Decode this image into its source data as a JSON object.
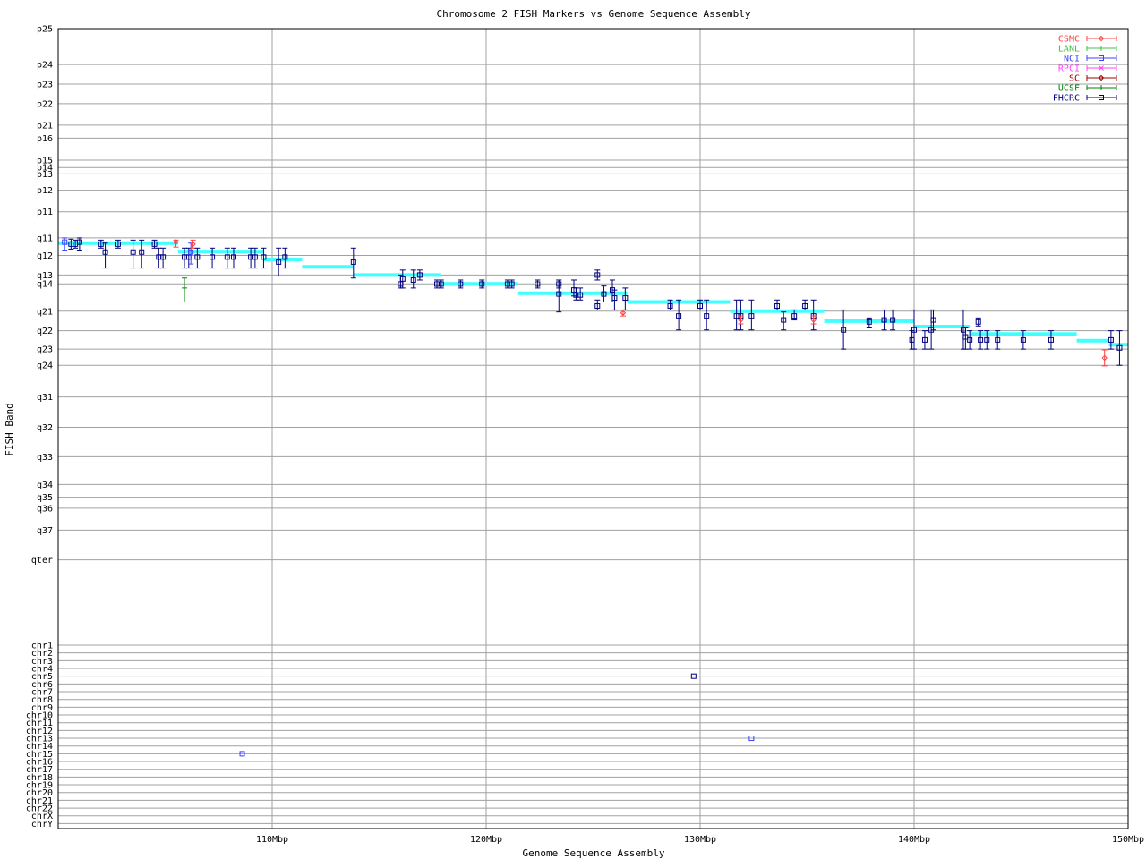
{
  "chart_data": {
    "type": "scatter",
    "title": "Chromosome 2 FISH Markers vs Genome Sequence Assembly",
    "xlabel": "Genome Sequence Assembly",
    "ylabel": "FISH Band",
    "x_range_mbp": [
      100,
      150
    ],
    "x_ticks": [
      {
        "value": 110,
        "label": "110Mbp"
      },
      {
        "value": 120,
        "label": "120Mbp"
      },
      {
        "value": 130,
        "label": "130Mbp"
      },
      {
        "value": 140,
        "label": "140Mbp"
      },
      {
        "value": 150,
        "label": "150Mbp"
      }
    ],
    "grid": true,
    "legend_position": "top-right",
    "bands": [
      {
        "label": "p25",
        "pos": 0
      },
      {
        "label": "p24",
        "pos": 1.8
      },
      {
        "label": "p23",
        "pos": 2.78
      },
      {
        "label": "p22",
        "pos": 3.76
      },
      {
        "label": "p21",
        "pos": 4.84
      },
      {
        "label": "p16",
        "pos": 5.49
      },
      {
        "label": "p15",
        "pos": 6.59
      },
      {
        "label": "p14",
        "pos": 6.96
      },
      {
        "label": "p13",
        "pos": 7.28
      },
      {
        "label": "p12",
        "pos": 8.1
      },
      {
        "label": "p11",
        "pos": 9.18
      },
      {
        "label": "q11",
        "pos": 10.49
      },
      {
        "label": "q12",
        "pos": 11.37
      },
      {
        "label": "q13",
        "pos": 12.35
      },
      {
        "label": "q14",
        "pos": 12.79
      },
      {
        "label": "q21",
        "pos": 14.16
      },
      {
        "label": "q22",
        "pos": 15.14
      },
      {
        "label": "q23",
        "pos": 16.06
      },
      {
        "label": "q24",
        "pos": 16.87
      },
      {
        "label": "q31",
        "pos": 18.46
      },
      {
        "label": "q32",
        "pos": 19.98
      },
      {
        "label": "q33",
        "pos": 21.45
      },
      {
        "label": "q34",
        "pos": 22.84
      },
      {
        "label": "q35",
        "pos": 23.48
      },
      {
        "label": "q36",
        "pos": 24.03
      },
      {
        "label": "q37",
        "pos": 25.13
      },
      {
        "label": "qter",
        "pos": 26.62
      }
    ],
    "chromosomes": [
      "chr1",
      "chr2",
      "chr3",
      "chr4",
      "chr5",
      "chr6",
      "chr7",
      "chr8",
      "chr9",
      "chr10",
      "chr11",
      "chr12",
      "chr13",
      "chr14",
      "chr15",
      "chr16",
      "chr17",
      "chr18",
      "chr19",
      "chr20",
      "chr21",
      "chr22",
      "chrX",
      "chrY"
    ],
    "legend": [
      {
        "name": "CSMC",
        "color": "#ff4040",
        "marker": "diamond"
      },
      {
        "name": "LANL",
        "color": "#40c040",
        "marker": "plus"
      },
      {
        "name": "NCI",
        "color": "#4040ff",
        "marker": "square"
      },
      {
        "name": "RPCI",
        "color": "#ff40ff",
        "marker": "cross"
      },
      {
        "name": "SC",
        "color": "#a00000",
        "marker": "diamond"
      },
      {
        "name": "UCSF",
        "color": "#008000",
        "marker": "plus"
      },
      {
        "name": "FHCRC",
        "color": "#000080",
        "marker": "square"
      }
    ],
    "band_segments": [
      {
        "x0": 100.0,
        "x1": 105.6,
        "y": 10.75,
        "color": "#40ffff"
      },
      {
        "x0": 105.6,
        "x1": 109.6,
        "y": 11.17,
        "color": "#40ffff"
      },
      {
        "x0": 109.6,
        "x1": 111.4,
        "y": 11.57,
        "color": "#40ffff"
      },
      {
        "x0": 111.4,
        "x1": 113.8,
        "y": 11.94,
        "color": "#40ffff"
      },
      {
        "x0": 113.8,
        "x1": 117.9,
        "y": 12.35,
        "color": "#40ffff"
      },
      {
        "x0": 117.9,
        "x1": 121.5,
        "y": 12.79,
        "color": "#40ffff"
      },
      {
        "x0": 121.5,
        "x1": 126.6,
        "y": 13.26,
        "color": "#40ffff"
      },
      {
        "x0": 126.6,
        "x1": 131.4,
        "y": 13.7,
        "color": "#40ffff"
      },
      {
        "x0": 131.4,
        "x1": 135.8,
        "y": 14.16,
        "color": "#40ffff"
      },
      {
        "x0": 135.8,
        "x1": 140.0,
        "y": 14.66,
        "color": "#40ffff"
      },
      {
        "x0": 140.0,
        "x1": 142.6,
        "y": 14.93,
        "color": "#40ffff"
      },
      {
        "x0": 142.6,
        "x1": 147.6,
        "y": 15.3,
        "color": "#40ffff"
      },
      {
        "x0": 147.6,
        "x1": 149.1,
        "y": 15.64,
        "color": "#40ffff"
      },
      {
        "x0": 149.1,
        "x1": 150.0,
        "y": 15.84,
        "color": "#40ffff"
      }
    ],
    "markers": [
      {
        "s": "NCI",
        "x": 100.3,
        "y": 10.7,
        "lo": 10.49,
        "hi": 11.1
      },
      {
        "s": "FHCRC",
        "x": 100.6,
        "y": 10.8,
        "lo": 10.55,
        "hi": 11.05
      },
      {
        "s": "FHCRC",
        "x": 100.8,
        "y": 10.8,
        "lo": 10.6,
        "hi": 11.0
      },
      {
        "s": "FHCRC",
        "x": 101.0,
        "y": 10.7,
        "lo": 10.49,
        "hi": 11.1
      },
      {
        "s": "FHCRC",
        "x": 102.0,
        "y": 10.8,
        "lo": 10.6,
        "hi": 11.0
      },
      {
        "s": "FHCRC",
        "x": 102.2,
        "y": 11.2,
        "lo": 10.75,
        "hi": 12.0
      },
      {
        "s": "FHCRC",
        "x": 102.8,
        "y": 10.8,
        "lo": 10.6,
        "hi": 11.0
      },
      {
        "s": "FHCRC",
        "x": 103.5,
        "y": 11.2,
        "lo": 10.6,
        "hi": 12.0
      },
      {
        "s": "FHCRC",
        "x": 103.9,
        "y": 11.2,
        "lo": 10.6,
        "hi": 12.0
      },
      {
        "s": "FHCRC",
        "x": 104.5,
        "y": 10.8,
        "lo": 10.6,
        "hi": 11.0
      },
      {
        "s": "FHCRC",
        "x": 104.7,
        "y": 11.45,
        "lo": 11.0,
        "hi": 12.0
      },
      {
        "s": "FHCRC",
        "x": 104.9,
        "y": 11.45,
        "lo": 11.0,
        "hi": 12.0
      },
      {
        "s": "CSMC",
        "x": 105.5,
        "y": 10.7,
        "lo": 10.6,
        "hi": 10.95
      },
      {
        "s": "FHCRC",
        "x": 105.9,
        "y": 11.45,
        "lo": 11.0,
        "hi": 12.0
      },
      {
        "s": "UCSF",
        "x": 105.9,
        "y": 13.0,
        "lo": 12.5,
        "hi": 13.7
      },
      {
        "s": "FHCRC",
        "x": 106.1,
        "y": 11.45,
        "lo": 11.0,
        "hi": 12.0
      },
      {
        "s": "NCI",
        "x": 106.2,
        "y": 11.2,
        "lo": 10.75,
        "hi": 11.8
      },
      {
        "s": "CSMC",
        "x": 106.3,
        "y": 10.8,
        "lo": 10.6,
        "hi": 11.0
      },
      {
        "s": "FHCRC",
        "x": 106.5,
        "y": 11.45,
        "lo": 11.0,
        "hi": 12.0
      },
      {
        "s": "FHCRC",
        "x": 107.2,
        "y": 11.45,
        "lo": 11.0,
        "hi": 12.0
      },
      {
        "s": "FHCRC",
        "x": 107.9,
        "y": 11.45,
        "lo": 11.0,
        "hi": 12.0
      },
      {
        "s": "FHCRC",
        "x": 108.2,
        "y": 11.45,
        "lo": 11.0,
        "hi": 12.0
      },
      {
        "s": "FHCRC",
        "x": 109.0,
        "y": 11.45,
        "lo": 11.0,
        "hi": 12.0
      },
      {
        "s": "FHCRC",
        "x": 109.2,
        "y": 11.45,
        "lo": 11.0,
        "hi": 12.0
      },
      {
        "s": "FHCRC",
        "x": 109.6,
        "y": 11.45,
        "lo": 11.0,
        "hi": 12.0
      },
      {
        "s": "FHCRC",
        "x": 110.3,
        "y": 11.7,
        "lo": 11.0,
        "hi": 12.4
      },
      {
        "s": "FHCRC",
        "x": 110.6,
        "y": 11.45,
        "lo": 11.0,
        "hi": 12.0
      },
      {
        "s": "FHCRC",
        "x": 113.8,
        "y": 11.7,
        "lo": 11.0,
        "hi": 12.5
      },
      {
        "s": "FHCRC",
        "x": 116.0,
        "y": 12.8,
        "lo": 12.35,
        "hi": 13.0
      },
      {
        "s": "FHCRC",
        "x": 116.1,
        "y": 12.55,
        "lo": 12.1,
        "hi": 13.0
      },
      {
        "s": "FHCRC",
        "x": 116.6,
        "y": 12.6,
        "lo": 12.1,
        "hi": 13.0
      },
      {
        "s": "FHCRC",
        "x": 116.9,
        "y": 12.35,
        "lo": 12.1,
        "hi": 12.6
      },
      {
        "s": "FHCRC",
        "x": 117.7,
        "y": 12.8,
        "lo": 12.6,
        "hi": 13.0
      },
      {
        "s": "FHCRC",
        "x": 117.9,
        "y": 12.8,
        "lo": 12.6,
        "hi": 13.0
      },
      {
        "s": "FHCRC",
        "x": 118.8,
        "y": 12.8,
        "lo": 12.6,
        "hi": 13.0
      },
      {
        "s": "FHCRC",
        "x": 119.8,
        "y": 12.8,
        "lo": 12.6,
        "hi": 13.0
      },
      {
        "s": "FHCRC",
        "x": 121.0,
        "y": 12.8,
        "lo": 12.6,
        "hi": 13.0
      },
      {
        "s": "FHCRC",
        "x": 121.2,
        "y": 12.8,
        "lo": 12.6,
        "hi": 13.0
      },
      {
        "s": "FHCRC",
        "x": 122.4,
        "y": 12.8,
        "lo": 12.6,
        "hi": 13.0
      },
      {
        "s": "FHCRC",
        "x": 123.4,
        "y": 12.8,
        "lo": 12.6,
        "hi": 13.0
      },
      {
        "s": "FHCRC",
        "x": 123.4,
        "y": 13.3,
        "lo": 12.6,
        "hi": 14.2
      },
      {
        "s": "FHCRC",
        "x": 124.1,
        "y": 13.1,
        "lo": 12.6,
        "hi": 13.4
      },
      {
        "s": "FHCRC",
        "x": 124.2,
        "y": 13.35,
        "lo": 13.0,
        "hi": 13.6
      },
      {
        "s": "FHCRC",
        "x": 124.4,
        "y": 13.35,
        "lo": 13.0,
        "hi": 13.6
      },
      {
        "s": "FHCRC",
        "x": 125.2,
        "y": 12.35,
        "lo": 12.1,
        "hi": 12.6
      },
      {
        "s": "FHCRC",
        "x": 125.2,
        "y": 13.9,
        "lo": 13.6,
        "hi": 14.1
      },
      {
        "s": "FHCRC",
        "x": 125.5,
        "y": 13.3,
        "lo": 12.9,
        "hi": 13.7
      },
      {
        "s": "FHCRC",
        "x": 125.9,
        "y": 13.1,
        "lo": 12.6,
        "hi": 13.7
      },
      {
        "s": "FHCRC",
        "x": 126.0,
        "y": 13.5,
        "lo": 13.1,
        "hi": 14.1
      },
      {
        "s": "FHCRC",
        "x": 126.5,
        "y": 13.5,
        "lo": 13.0,
        "hi": 14.1
      },
      {
        "s": "CSMC",
        "x": 126.4,
        "y": 14.25,
        "lo": 14.1,
        "hi": 14.4
      },
      {
        "s": "FHCRC",
        "x": 128.6,
        "y": 13.9,
        "lo": 13.6,
        "hi": 14.1
      },
      {
        "s": "FHCRC",
        "x": 129.0,
        "y": 14.4,
        "lo": 13.6,
        "hi": 15.1
      },
      {
        "s": "FHCRC",
        "x": 130.0,
        "y": 13.9,
        "lo": 13.6,
        "hi": 14.1
      },
      {
        "s": "FHCRC",
        "x": 130.3,
        "y": 14.4,
        "lo": 13.6,
        "hi": 15.1
      },
      {
        "s": "FHCRC",
        "x": 131.7,
        "y": 14.4,
        "lo": 13.6,
        "hi": 15.1
      },
      {
        "s": "FHCRC",
        "x": 131.9,
        "y": 14.4,
        "lo": 13.6,
        "hi": 15.1
      },
      {
        "s": "CSMC",
        "x": 131.9,
        "y": 14.6,
        "lo": 14.4,
        "hi": 14.8
      },
      {
        "s": "FHCRC",
        "x": 132.4,
        "y": 14.4,
        "lo": 13.6,
        "hi": 15.1
      },
      {
        "s": "FHCRC",
        "x": 133.6,
        "y": 13.9,
        "lo": 13.6,
        "hi": 14.1
      },
      {
        "s": "FHCRC",
        "x": 133.9,
        "y": 14.6,
        "lo": 14.2,
        "hi": 15.1
      },
      {
        "s": "FHCRC",
        "x": 134.4,
        "y": 14.4,
        "lo": 14.1,
        "hi": 14.6
      },
      {
        "s": "FHCRC",
        "x": 134.9,
        "y": 13.9,
        "lo": 13.6,
        "hi": 14.1
      },
      {
        "s": "FHCRC",
        "x": 135.3,
        "y": 14.4,
        "lo": 13.6,
        "hi": 15.1
      },
      {
        "s": "CSMC",
        "x": 135.3,
        "y": 14.6,
        "lo": 14.4,
        "hi": 14.8
      },
      {
        "s": "FHCRC",
        "x": 136.7,
        "y": 15.1,
        "lo": 14.1,
        "hi": 16.06
      },
      {
        "s": "FHCRC",
        "x": 137.9,
        "y": 14.7,
        "lo": 14.5,
        "hi": 15.0
      },
      {
        "s": "FHCRC",
        "x": 138.6,
        "y": 14.6,
        "lo": 14.1,
        "hi": 15.1
      },
      {
        "s": "FHCRC",
        "x": 139.0,
        "y": 14.6,
        "lo": 14.1,
        "hi": 15.1
      },
      {
        "s": "FHCRC",
        "x": 139.9,
        "y": 15.6,
        "lo": 15.14,
        "hi": 16.06
      },
      {
        "s": "FHCRC",
        "x": 140.0,
        "y": 15.1,
        "lo": 14.1,
        "hi": 16.06
      },
      {
        "s": "FHCRC",
        "x": 140.5,
        "y": 15.6,
        "lo": 15.14,
        "hi": 16.06
      },
      {
        "s": "FHCRC",
        "x": 140.8,
        "y": 15.1,
        "lo": 14.1,
        "hi": 16.06
      },
      {
        "s": "FHCRC",
        "x": 140.9,
        "y": 14.6,
        "lo": 14.1,
        "hi": 15.1
      },
      {
        "s": "FHCRC",
        "x": 142.3,
        "y": 15.1,
        "lo": 14.1,
        "hi": 16.06
      },
      {
        "s": "FHCRC",
        "x": 142.4,
        "y": 15.45,
        "lo": 15.0,
        "hi": 16.06
      },
      {
        "s": "FHCRC",
        "x": 142.6,
        "y": 15.6,
        "lo": 15.14,
        "hi": 16.06
      },
      {
        "s": "FHCRC",
        "x": 143.0,
        "y": 14.7,
        "lo": 14.5,
        "hi": 14.9
      },
      {
        "s": "FHCRC",
        "x": 143.1,
        "y": 15.6,
        "lo": 15.14,
        "hi": 16.06
      },
      {
        "s": "FHCRC",
        "x": 143.4,
        "y": 15.6,
        "lo": 15.14,
        "hi": 16.06
      },
      {
        "s": "FHCRC",
        "x": 143.9,
        "y": 15.6,
        "lo": 15.14,
        "hi": 16.06
      },
      {
        "s": "FHCRC",
        "x": 145.1,
        "y": 15.6,
        "lo": 15.14,
        "hi": 16.06
      },
      {
        "s": "FHCRC",
        "x": 146.4,
        "y": 15.6,
        "lo": 15.14,
        "hi": 16.06
      },
      {
        "s": "CSMC",
        "x": 148.9,
        "y": 16.5,
        "lo": 16.1,
        "hi": 16.9
      },
      {
        "s": "FHCRC",
        "x": 149.2,
        "y": 15.6,
        "lo": 15.14,
        "hi": 16.06
      },
      {
        "s": "FHCRC",
        "x": 149.6,
        "y": 16.0,
        "lo": 15.14,
        "hi": 16.87
      }
    ],
    "off_chromosome": [
      {
        "s": "NCI",
        "x": 108.6,
        "chr": "chr15"
      },
      {
        "s": "FHCRC",
        "x": 129.7,
        "chr": "chr5"
      },
      {
        "s": "NCI",
        "x": 132.4,
        "chr": "chr13"
      }
    ]
  }
}
